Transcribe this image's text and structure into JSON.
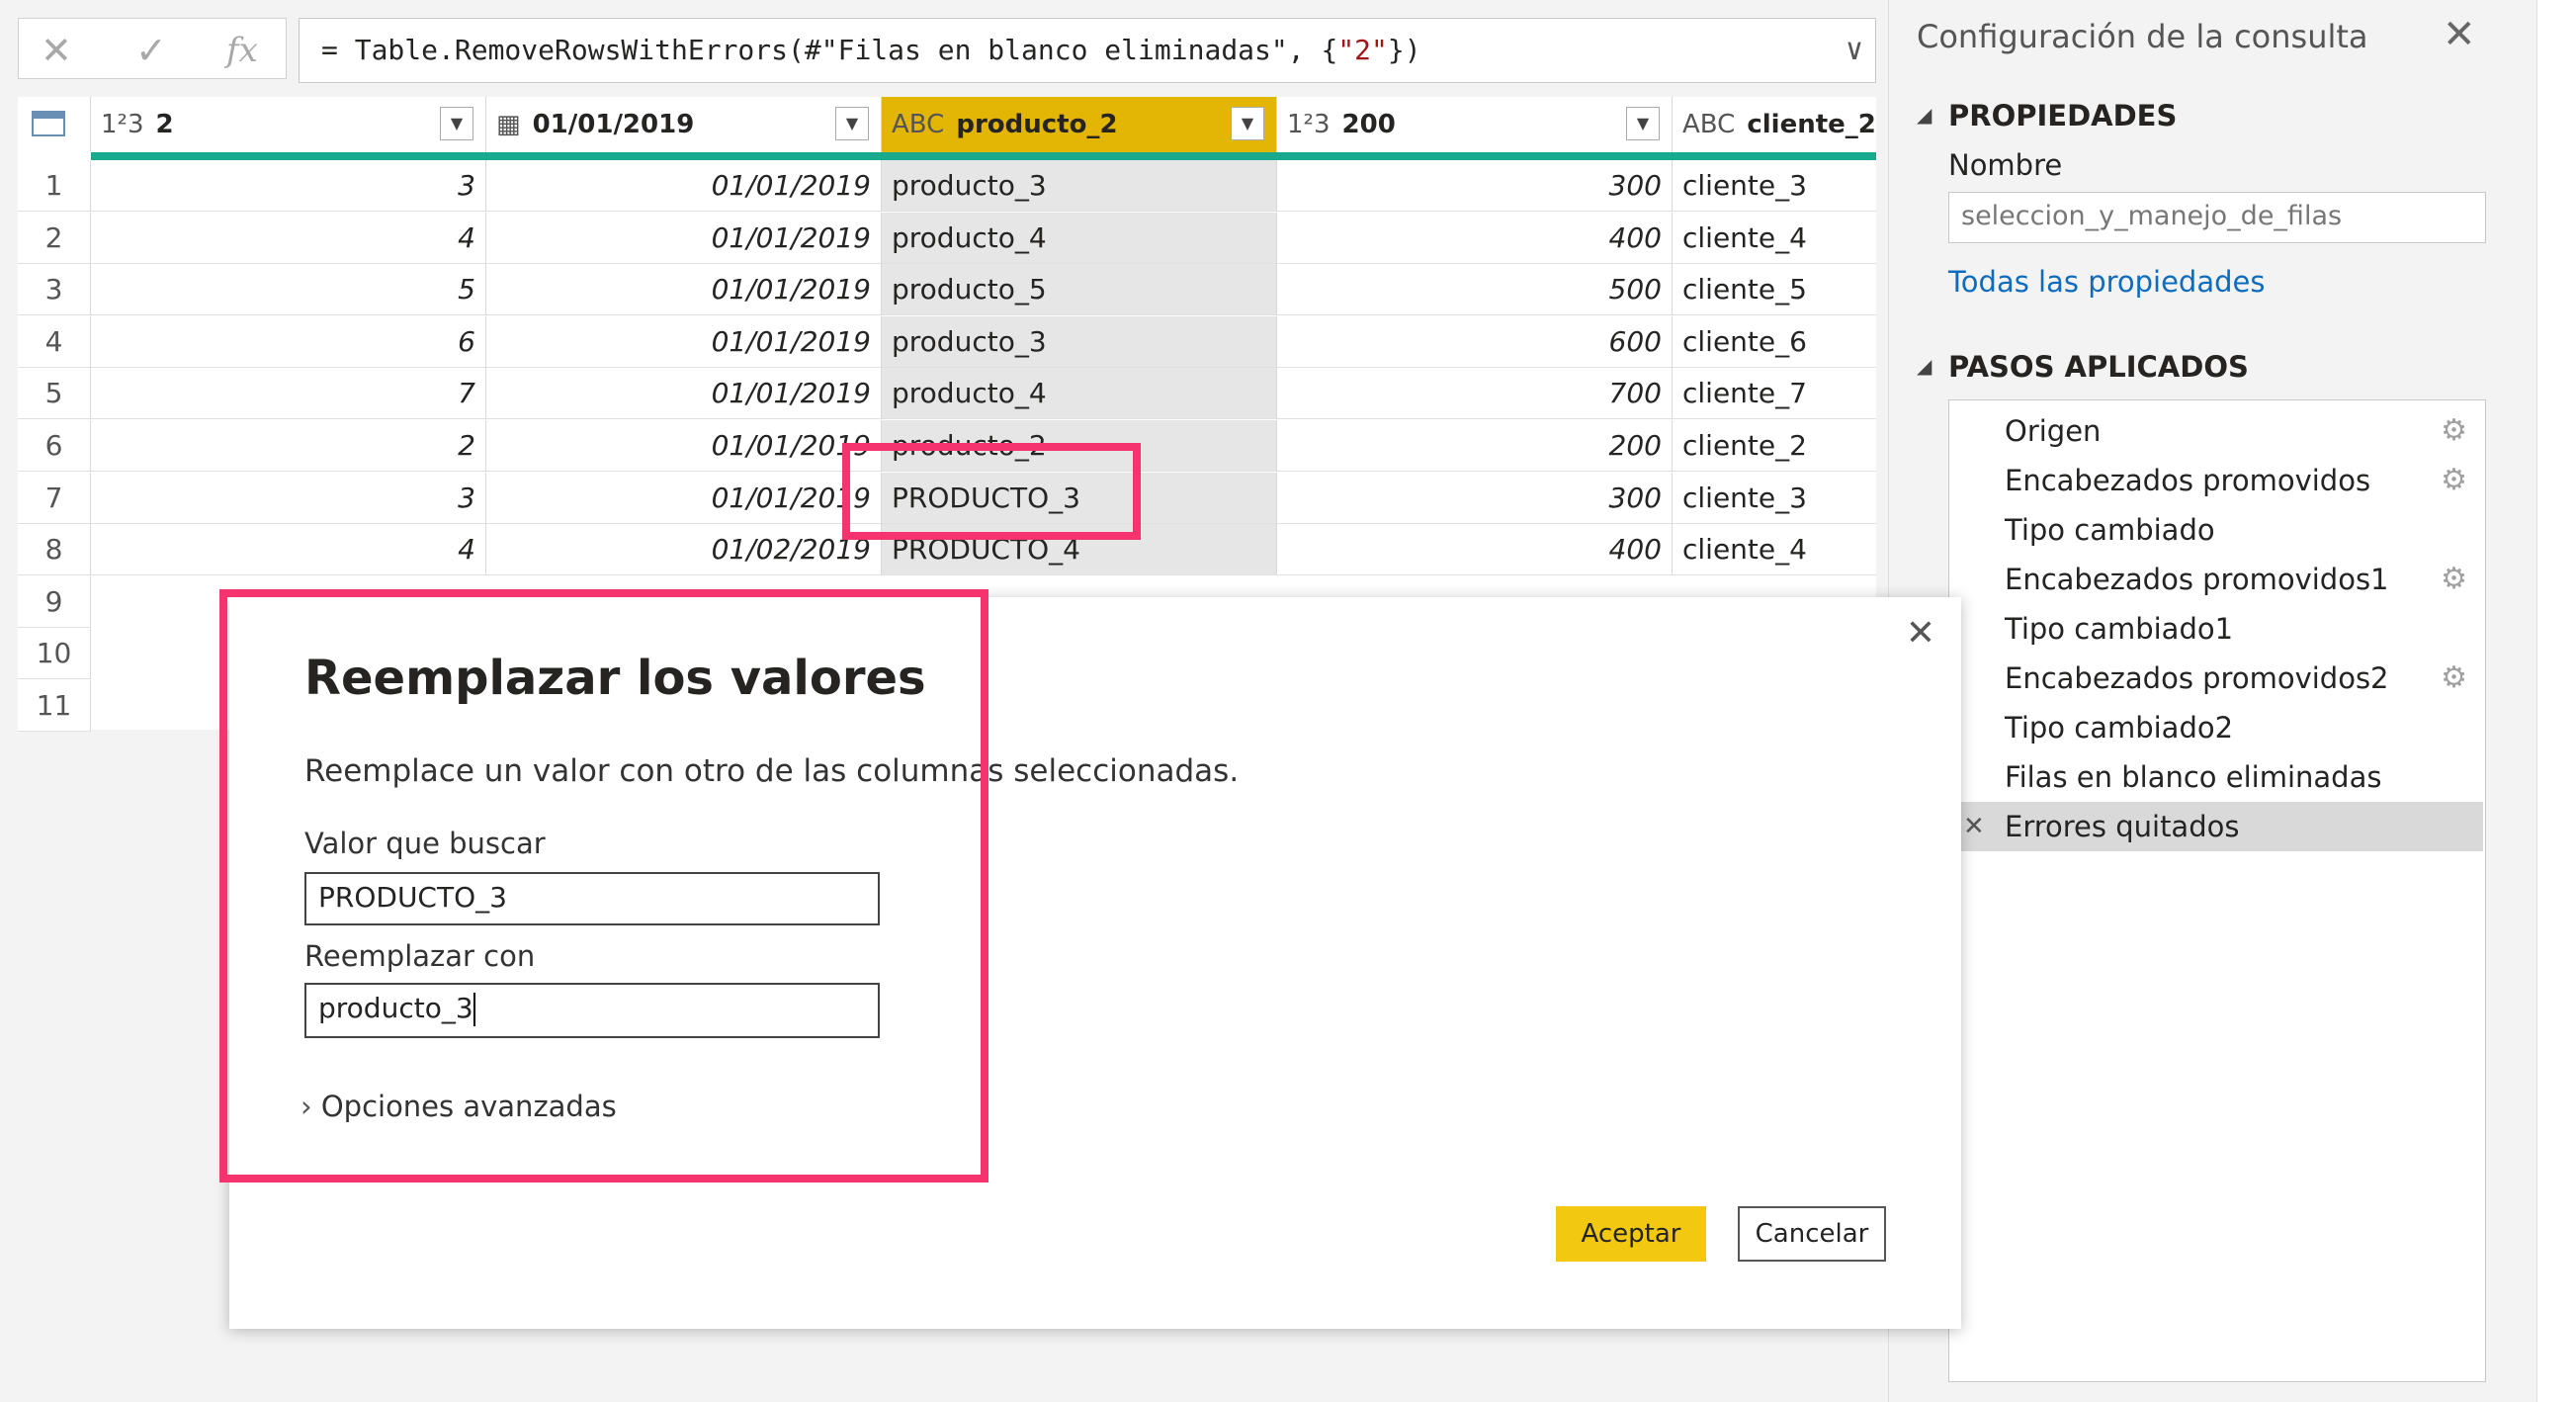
{
  "formula": {
    "cancel_icon": "✕",
    "commit_icon": "✓",
    "fx_label": "fx",
    "prefix": "= Table.RemoveRowsWithErrors(#",
    "step_ref": "\"Filas en blanco eliminadas\"",
    "middle": ", {",
    "col_ref": "\"2\"",
    "suffix": "})"
  },
  "grid": {
    "columns": [
      {
        "type_label": "1²3",
        "name": "2"
      },
      {
        "type_label": "▦",
        "name": "01/01/2019"
      },
      {
        "type_label": "ABC",
        "name": "producto_2"
      },
      {
        "type_label": "1²3",
        "name": "200"
      },
      {
        "type_label": "ABC",
        "name": "cliente_2"
      }
    ],
    "rows": [
      {
        "n": "1",
        "c0": "3",
        "c1": "01/01/2019",
        "c2": "producto_3",
        "c3": "300",
        "c4": "cliente_3"
      },
      {
        "n": "2",
        "c0": "4",
        "c1": "01/01/2019",
        "c2": "producto_4",
        "c3": "400",
        "c4": "cliente_4"
      },
      {
        "n": "3",
        "c0": "5",
        "c1": "01/01/2019",
        "c2": "producto_5",
        "c3": "500",
        "c4": "cliente_5"
      },
      {
        "n": "4",
        "c0": "6",
        "c1": "01/01/2019",
        "c2": "producto_3",
        "c3": "600",
        "c4": "cliente_6"
      },
      {
        "n": "5",
        "c0": "7",
        "c1": "01/01/2019",
        "c2": "producto_4",
        "c3": "700",
        "c4": "cliente_7"
      },
      {
        "n": "6",
        "c0": "2",
        "c1": "01/01/2019",
        "c2": "producto_2",
        "c3": "200",
        "c4": "cliente_2"
      },
      {
        "n": "7",
        "c0": "3",
        "c1": "01/01/2019",
        "c2": "PRODUCTO_3",
        "c3": "300",
        "c4": "cliente_3"
      },
      {
        "n": "8",
        "c0": "4",
        "c1": "01/02/2019",
        "c2": "PRODUCTO_4",
        "c3": "400",
        "c4": "cliente_4"
      },
      {
        "n": "9"
      },
      {
        "n": "10"
      },
      {
        "n": "11"
      }
    ]
  },
  "query_settings": {
    "title": "Configuración de la consulta",
    "properties_heading": "PROPIEDADES",
    "name_label": "Nombre",
    "name_value": "seleccion_y_manejo_de_filas",
    "all_properties_link": "Todas las propiedades",
    "steps_heading": "PASOS APLICADOS",
    "steps": [
      {
        "label": "Origen",
        "has_gear": true
      },
      {
        "label": "Encabezados promovidos",
        "has_gear": true
      },
      {
        "label": "Tipo cambiado",
        "has_gear": false
      },
      {
        "label": "Encabezados promovidos1",
        "has_gear": true
      },
      {
        "label": "Tipo cambiado1",
        "has_gear": false
      },
      {
        "label": "Encabezados promovidos2",
        "has_gear": true
      },
      {
        "label": "Tipo cambiado2",
        "has_gear": false
      },
      {
        "label": "Filas en blanco eliminadas",
        "has_gear": false
      },
      {
        "label": "Errores quitados",
        "has_gear": false,
        "selected": true
      }
    ]
  },
  "dialog": {
    "title": "Reemplazar los valores",
    "description": "Reemplace un valor con otro de las columnas seleccionadas.",
    "find_label": "Valor que buscar",
    "find_value": "PRODUCTO_3",
    "replace_label": "Reemplazar con",
    "replace_value": "producto_3",
    "advanced_label": "Opciones avanzadas",
    "ok_label": "Aceptar",
    "cancel_label": "Cancelar"
  },
  "colors": {
    "selected_column_header": "#e3b505",
    "column_quality_bar": "#19a98d",
    "highlight_box": "#f5336e",
    "primary_button": "#f2c811",
    "link": "#0f6cbd"
  }
}
